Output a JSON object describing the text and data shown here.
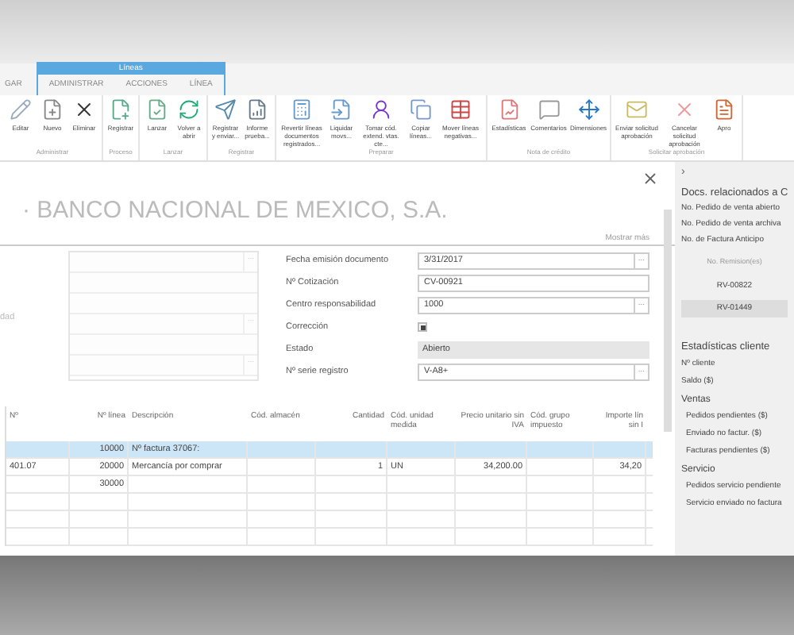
{
  "ribbon": {
    "context_group": "Líneas",
    "tabs": [
      {
        "label": "GAR",
        "selected": false
      },
      {
        "label": "ADMINISTRAR",
        "selected": false
      },
      {
        "label": "ACCIONES",
        "selected": false
      },
      {
        "label": "LÍNEA",
        "selected": false
      }
    ],
    "groups": [
      {
        "label": "Administrar",
        "buttons": [
          "Editar",
          "Nuevo",
          "Eliminar"
        ]
      },
      {
        "label": "Proceso",
        "buttons": [
          "Registrar"
        ]
      },
      {
        "label": "Lanzar",
        "buttons": [
          "Lanzar",
          "Volver a abrir"
        ]
      },
      {
        "label": "Registrar",
        "buttons": [
          "Registrar y enviar...",
          "Informe prueba..."
        ]
      },
      {
        "label": "Preparar",
        "buttons": [
          "Revertir líneas documentos registrados...",
          "Liquidar movs...",
          "Tomar cód. extend. vtas. cte...",
          "Copiar líneas...",
          "Mover líneas negativas..."
        ]
      },
      {
        "label": "Nota de crédito",
        "buttons": [
          "Estadísticas",
          "Comentarios",
          "Dimensiones"
        ]
      },
      {
        "label": "Solicitar aprobación",
        "buttons": [
          "Enviar solicitud aprobación",
          "Cancelar solicitud aprobación",
          "Apro"
        ]
      }
    ]
  },
  "page": {
    "title": "· BANCO NACIONAL DE MEXICO, S.A.",
    "show_more": "Mostrar más",
    "lookup_label": "...",
    "left_label": "dad",
    "left_fields": [
      {
        "lookup": true
      },
      {
        "lookup": false
      },
      {
        "lookup": false
      },
      {
        "lookup": true
      },
      {
        "lookup": false
      },
      {
        "lookup": true
      }
    ],
    "fields": [
      {
        "label": "Fecha emisión documento",
        "kind": "text",
        "value": "3/31/2017",
        "lookup": true
      },
      {
        "label": "Nº Cotización",
        "kind": "text",
        "value": "CV-00921",
        "lookup": false
      },
      {
        "label": "Centro responsabilidad",
        "kind": "text",
        "value": "1000",
        "lookup": true
      },
      {
        "label": "Corrección",
        "kind": "checkbox",
        "checked": true
      },
      {
        "label": "Estado",
        "kind": "readonly",
        "value": "Abierto"
      },
      {
        "label": "Nº serie registro",
        "kind": "text",
        "value": "V-A8+",
        "lookup": true
      }
    ]
  },
  "lines": {
    "columns": [
      "Nº",
      "Nº línea",
      "Descripción",
      "Cód. almacén",
      "Cantidad",
      "Cód. unidad medida",
      "Precio unitario sin IVA",
      "Cód. grupo impuesto",
      "Importe lín sin I"
    ],
    "rows": [
      {
        "selected": true,
        "cells": [
          "",
          "10000",
          "Nº factura 37067:",
          "",
          "",
          "",
          "",
          "",
          ""
        ]
      },
      {
        "selected": false,
        "cells": [
          "401.07",
          "20000",
          "Mercancía por comprar",
          "",
          "1",
          "UN",
          "34,200.00",
          "",
          "34,20"
        ]
      },
      {
        "selected": false,
        "cells": [
          "",
          "30000",
          "",
          "",
          "",
          "",
          "",
          "",
          ""
        ]
      },
      {
        "selected": false,
        "cells": [
          "",
          "",
          "",
          "",
          "",
          "",
          "",
          "",
          ""
        ]
      },
      {
        "selected": false,
        "cells": [
          "",
          "",
          "",
          "",
          "",
          "",
          "",
          "",
          ""
        ]
      },
      {
        "selected": false,
        "cells": [
          "",
          "",
          "",
          "",
          "",
          "",
          "",
          "",
          ""
        ]
      }
    ]
  },
  "factbox": {
    "toggle": "›",
    "title": "Docs. relacionados a C",
    "items": [
      "No. Pedido de venta abierto",
      "No. Pedido de venta archiva",
      "No. de Factura Anticipo"
    ],
    "sub_header": "No. Remision(es)",
    "shipments": [
      {
        "label": "RV-00822",
        "selected": false
      },
      {
        "label": "RV-01449",
        "selected": true
      }
    ],
    "stats_title": "Estadísticas cliente",
    "stats": [
      {
        "kind": "item",
        "label": "Nº cliente"
      },
      {
        "kind": "item",
        "label": "Saldo ($)"
      },
      {
        "kind": "heading",
        "label": "Ventas"
      },
      {
        "kind": "sub",
        "label": "Pedidos pendientes ($)"
      },
      {
        "kind": "sub",
        "label": "Enviado no factur. ($)"
      },
      {
        "kind": "sub",
        "label": "Facturas pendientes ($)"
      },
      {
        "kind": "heading",
        "label": "Servicio"
      },
      {
        "kind": "sub",
        "label": "Pedidos servicio pendiente"
      },
      {
        "kind": "sub",
        "label": "Servicio enviado no factura"
      }
    ]
  }
}
